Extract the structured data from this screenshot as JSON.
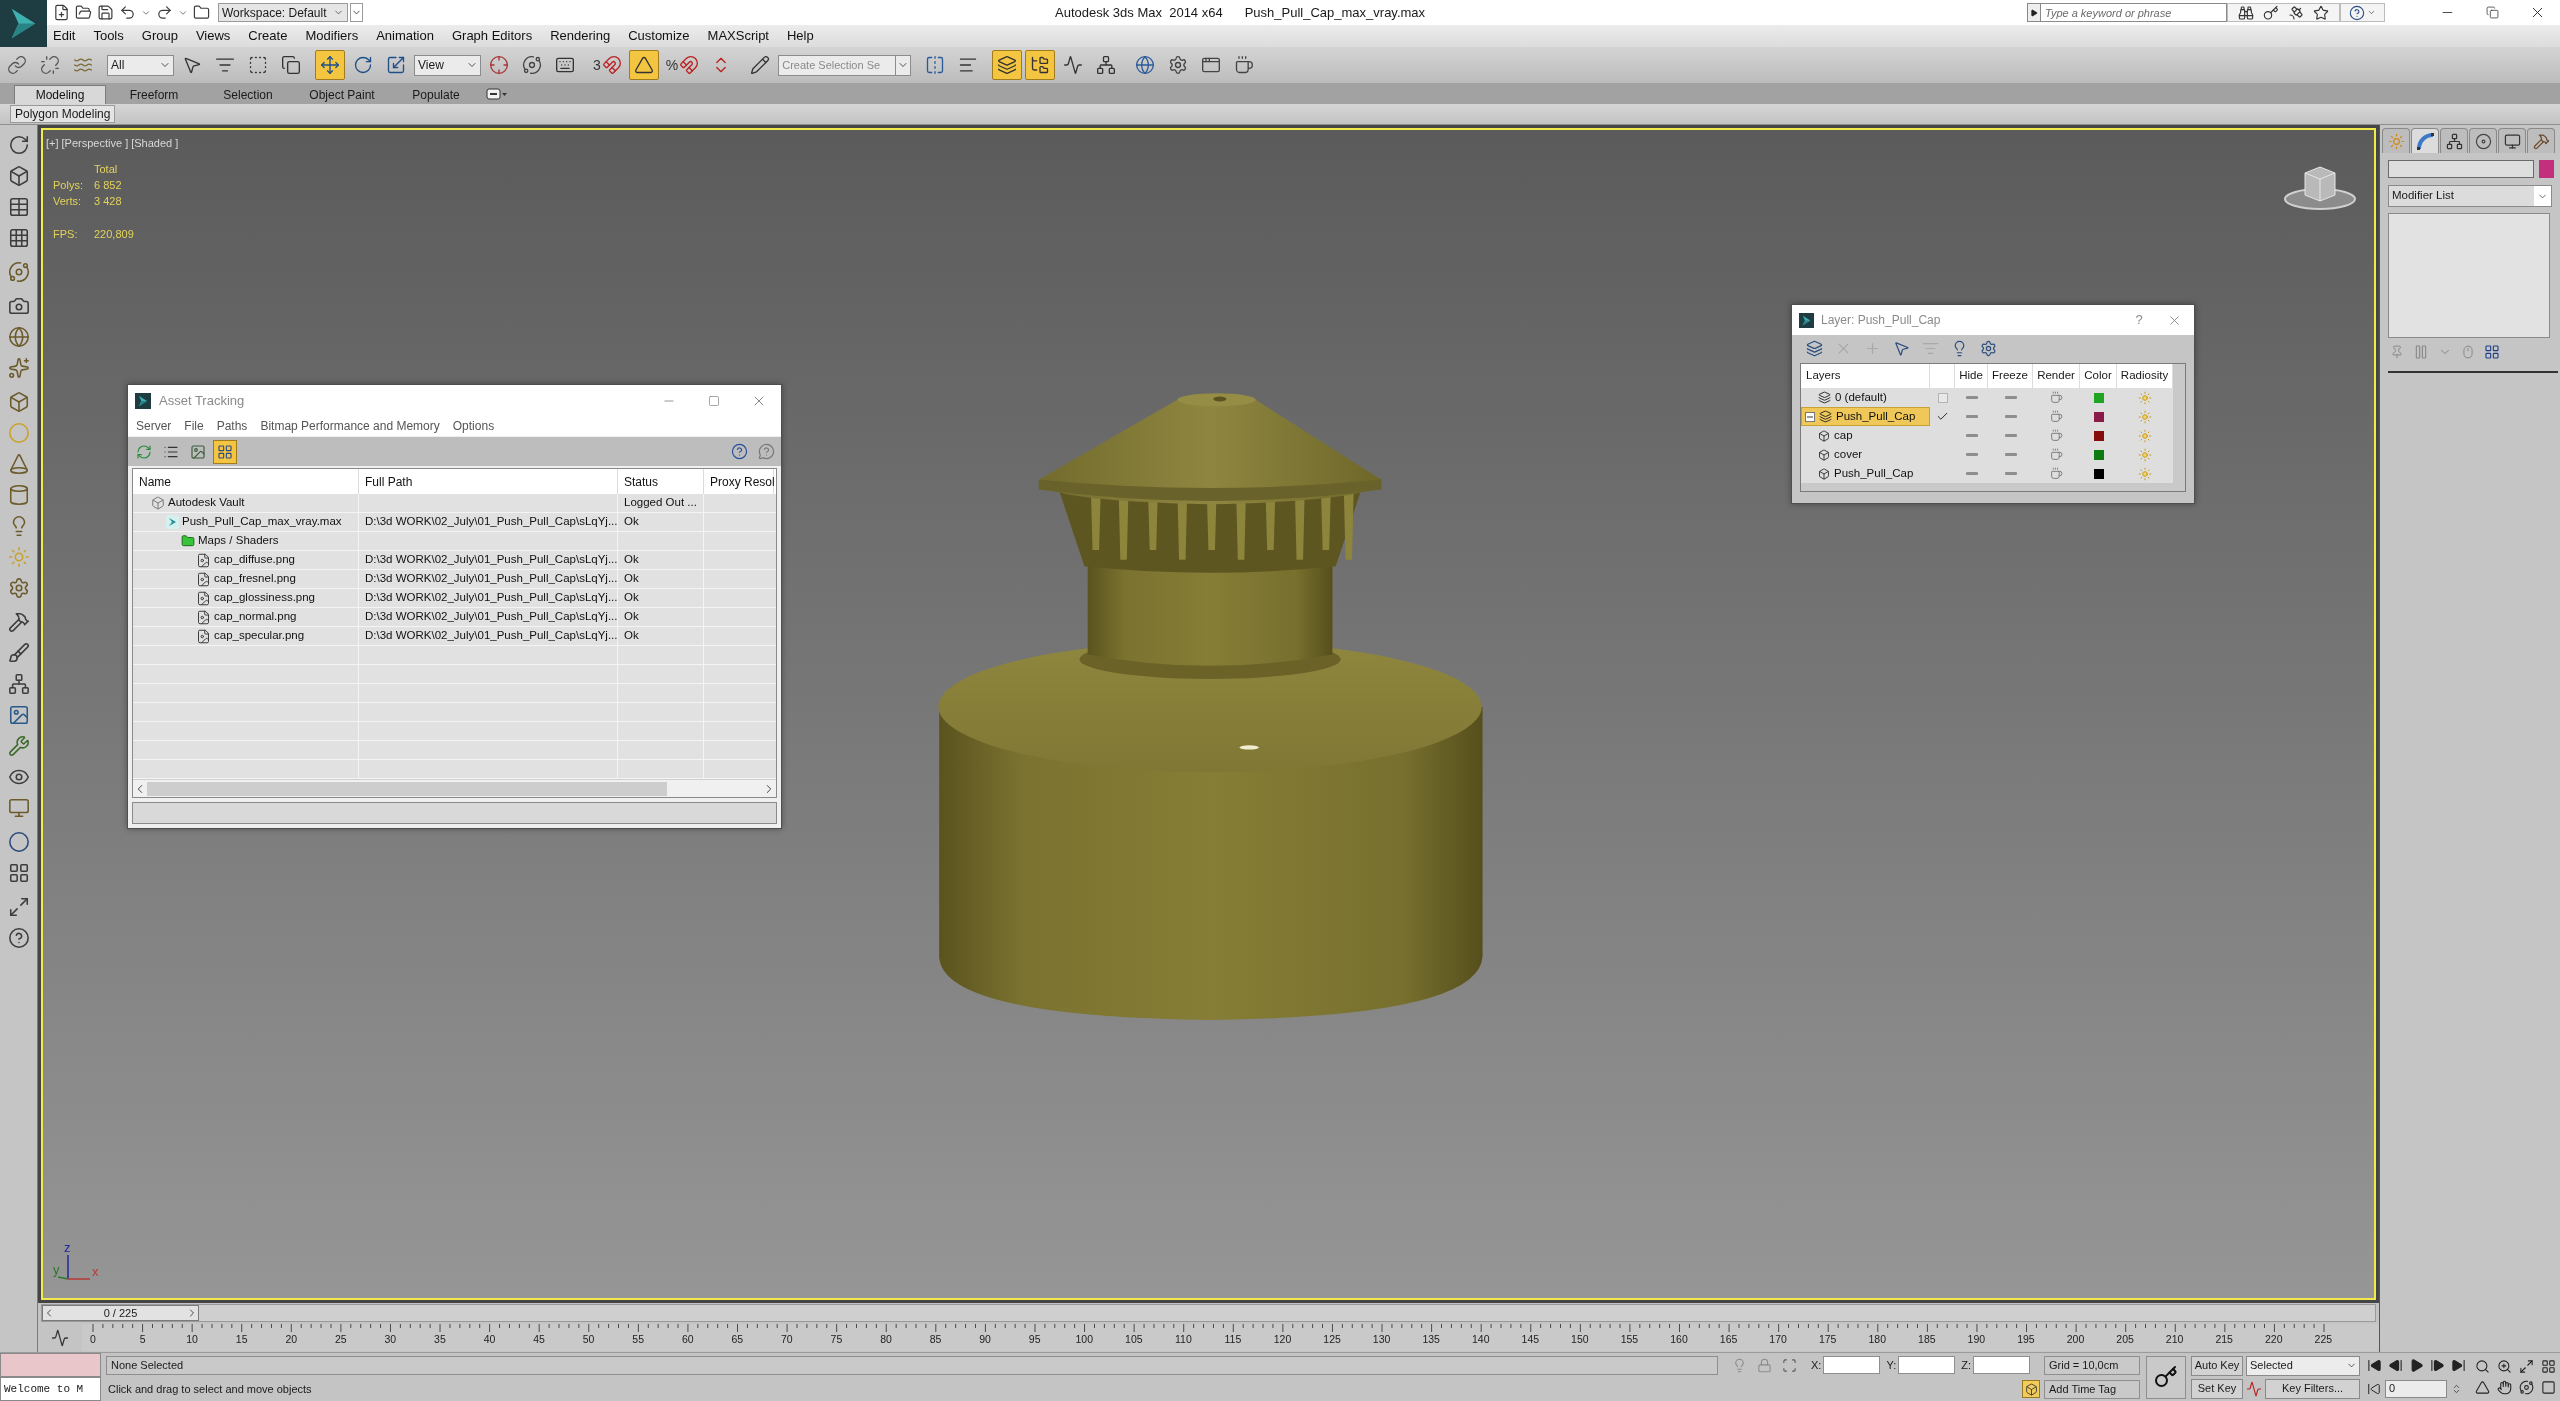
{
  "window": {
    "title": "Autodesk 3ds Max  2014 x64",
    "document": "Push_Pull_Cap_max_vray.max"
  },
  "quick_access": {
    "workspace": "Workspace: Default"
  },
  "help_search": {
    "placeholder": "Type a keyword or phrase"
  },
  "menu": [
    "Edit",
    "Tools",
    "Group",
    "Views",
    "Create",
    "Modifiers",
    "Animation",
    "Graph Editors",
    "Rendering",
    "Customize",
    "MAXScript",
    "Help"
  ],
  "main_toolbar": [
    [
      {
        "kind": "icon",
        "selected": false
      },
      {
        "kind": "icon",
        "selected": false
      },
      {
        "kind": "icon",
        "selected": false
      }
    ],
    [
      {
        "kind": "dropdown",
        "value": "All"
      },
      {
        "kind": "icon",
        "selected": false
      },
      {
        "kind": "icon",
        "selected": false
      },
      {
        "kind": "icon",
        "selected": false
      },
      {
        "kind": "icon",
        "selected": false
      }
    ],
    [
      {
        "kind": "icon",
        "selected": true
      },
      {
        "kind": "icon",
        "selected": false
      },
      {
        "kind": "icon",
        "selected": false
      },
      {
        "kind": "dropdown",
        "value": "View"
      },
      {
        "kind": "icon",
        "selected": false
      },
      {
        "kind": "icon",
        "selected": false
      },
      {
        "kind": "icon",
        "selected": false
      }
    ],
    [
      {
        "kind": "icon",
        "selected": false,
        "label": "3"
      },
      {
        "kind": "icon",
        "selected": true
      },
      {
        "kind": "icon",
        "selected": false,
        "label": "%"
      },
      {
        "kind": "icon",
        "selected": false
      }
    ],
    [
      {
        "kind": "icon",
        "selected": false
      },
      {
        "kind": "combo",
        "placeholder": "Create Selection Se"
      }
    ],
    [
      {
        "kind": "icon",
        "selected": false
      },
      {
        "kind": "icon",
        "selected": false
      }
    ],
    [
      {
        "kind": "icon",
        "selected": true
      },
      {
        "kind": "icon",
        "selected": true
      },
      {
        "kind": "icon",
        "selected": false
      },
      {
        "kind": "icon",
        "selected": false
      }
    ],
    [
      {
        "kind": "icon",
        "selected": false
      },
      {
        "kind": "icon",
        "selected": false
      },
      {
        "kind": "icon",
        "selected": false
      },
      {
        "kind": "icon",
        "selected": false
      }
    ]
  ],
  "ribbon": {
    "tabs": [
      {
        "label": "Modeling",
        "selected": true
      },
      {
        "label": "Freeform",
        "selected": false
      },
      {
        "label": "Selection",
        "selected": false
      },
      {
        "label": "Object Paint",
        "selected": false
      },
      {
        "label": "Populate",
        "selected": false
      }
    ],
    "panel": "Polygon Modeling"
  },
  "viewport": {
    "labels": [
      "[+]",
      "[Perspective ]",
      "[Shaded ]"
    ],
    "stats": {
      "title": "Total",
      "rows": [
        {
          "label": "Polys:",
          "value": "6 852"
        },
        {
          "label": "Verts:",
          "value": "3 428"
        }
      ],
      "fps": {
        "label": "FPS:",
        "value": "220,809"
      }
    },
    "axes": [
      "z",
      "y",
      "x"
    ]
  },
  "asset_tracking": {
    "title": "Asset Tracking",
    "menu": [
      "Server",
      "File",
      "Paths",
      "Bitmap Performance and Memory",
      "Options"
    ],
    "toolbar": [
      {
        "selected": false
      },
      {
        "selected": false
      },
      {
        "selected": false
      },
      {
        "selected": true
      }
    ],
    "columns": [
      "Name",
      "Full Path",
      "Status",
      "Proxy Resol"
    ],
    "rows": [
      {
        "kind": "server",
        "name": "Autodesk Vault",
        "status": "Logged Out ...",
        "children": [
          {
            "kind": "scene",
            "name": "Push_Pull_Cap_max_vray.max",
            "full_path": "D:\\3d WORK\\02_July\\01_Push_Pull_Cap\\sLqYj...",
            "status": "Ok",
            "children": [
              {
                "kind": "group",
                "name": "Maps / Shaders",
                "children": [
                  {
                    "kind": "file",
                    "name": "cap_diffuse.png",
                    "full_path": "D:\\3d WORK\\02_July\\01_Push_Pull_Cap\\sLqYj...",
                    "status": "Ok"
                  },
                  {
                    "kind": "file",
                    "name": "cap_fresnel.png",
                    "full_path": "D:\\3d WORK\\02_July\\01_Push_Pull_Cap\\sLqYj...",
                    "status": "Ok"
                  },
                  {
                    "kind": "file",
                    "name": "cap_glossiness.png",
                    "full_path": "D:\\3d WORK\\02_July\\01_Push_Pull_Cap\\sLqYj...",
                    "status": "Ok"
                  },
                  {
                    "kind": "file",
                    "name": "cap_normal.png",
                    "full_path": "D:\\3d WORK\\02_July\\01_Push_Pull_Cap\\sLqYj...",
                    "status": "Ok"
                  },
                  {
                    "kind": "file",
                    "name": "cap_specular.png",
                    "full_path": "D:\\3d WORK\\02_July\\01_Push_Pull_Cap\\sLqYj...",
                    "status": "Ok"
                  }
                ]
              }
            ]
          }
        ]
      }
    ]
  },
  "layer_window": {
    "title": "Layer: Push_Pull_Cap",
    "help": "?",
    "toolbar": [
      {
        "disabled": false
      },
      {
        "disabled": true
      },
      {
        "disabled": true
      },
      {
        "disabled": false
      },
      {
        "disabled": true
      },
      {
        "disabled": false
      },
      {
        "disabled": false
      }
    ],
    "columns": [
      "Layers",
      "Hide",
      "Freeze",
      "Render",
      "Color",
      "Radiosity"
    ],
    "rows": [
      {
        "kind": "layer",
        "name": "0 (default)",
        "current": false,
        "selected": false,
        "hidden": false,
        "frozen": false,
        "color": "#1fa51f"
      },
      {
        "kind": "layer",
        "name": "Push_Pull_Cap",
        "current": true,
        "selected": true,
        "expanded": true,
        "hidden": false,
        "frozen": false,
        "color": "#8a1a48",
        "children": [
          {
            "kind": "object",
            "name": "cap",
            "selected": false,
            "hidden": false,
            "frozen": false,
            "color": "#870b0b"
          },
          {
            "kind": "object",
            "name": "cover",
            "selected": false,
            "hidden": false,
            "frozen": false,
            "color": "#0d7a12"
          },
          {
            "kind": "object",
            "name": "Push_Pull_Cap",
            "selected": false,
            "hidden": false,
            "frozen": false,
            "color": "#000000"
          }
        ]
      }
    ]
  },
  "command_panel": {
    "tabs": [
      {
        "selected": false
      },
      {
        "selected": true
      },
      {
        "selected": false
      },
      {
        "selected": false
      },
      {
        "selected": false
      },
      {
        "selected": false
      }
    ],
    "modifier_list": "Modifier List"
  },
  "time_slider": {
    "label": "0 / 225",
    "level": 0
  },
  "timeline": {
    "ticks": [
      "0",
      "5",
      "10",
      "15",
      "20",
      "25",
      "30",
      "35",
      "40",
      "45",
      "50",
      "55",
      "60",
      "65",
      "70",
      "75",
      "80",
      "85",
      "90",
      "95",
      "100",
      "105",
      "110",
      "115",
      "120",
      "125",
      "130",
      "135",
      "140",
      "145",
      "150",
      "155",
      "160",
      "165",
      "170",
      "175",
      "180",
      "185",
      "190",
      "195",
      "200",
      "205",
      "210",
      "215",
      "220",
      "225"
    ]
  },
  "listener": {
    "text": "Welcome to M"
  },
  "status": {
    "selection": "None Selected",
    "prompt": "Click and drag to select and move objects"
  },
  "coordinates": [
    {
      "label": "X:"
    },
    {
      "label": "Y:"
    },
    {
      "label": "Z:"
    }
  ],
  "grid": "Grid = 10,0cm",
  "time_tag": "Add Time Tag",
  "animation": {
    "auto_key": {
      "label": "Auto Key",
      "on": false
    },
    "key_mode": "Selected",
    "set_key": "Set Key",
    "key_filters": "Key Filters...",
    "frame": "0"
  }
}
